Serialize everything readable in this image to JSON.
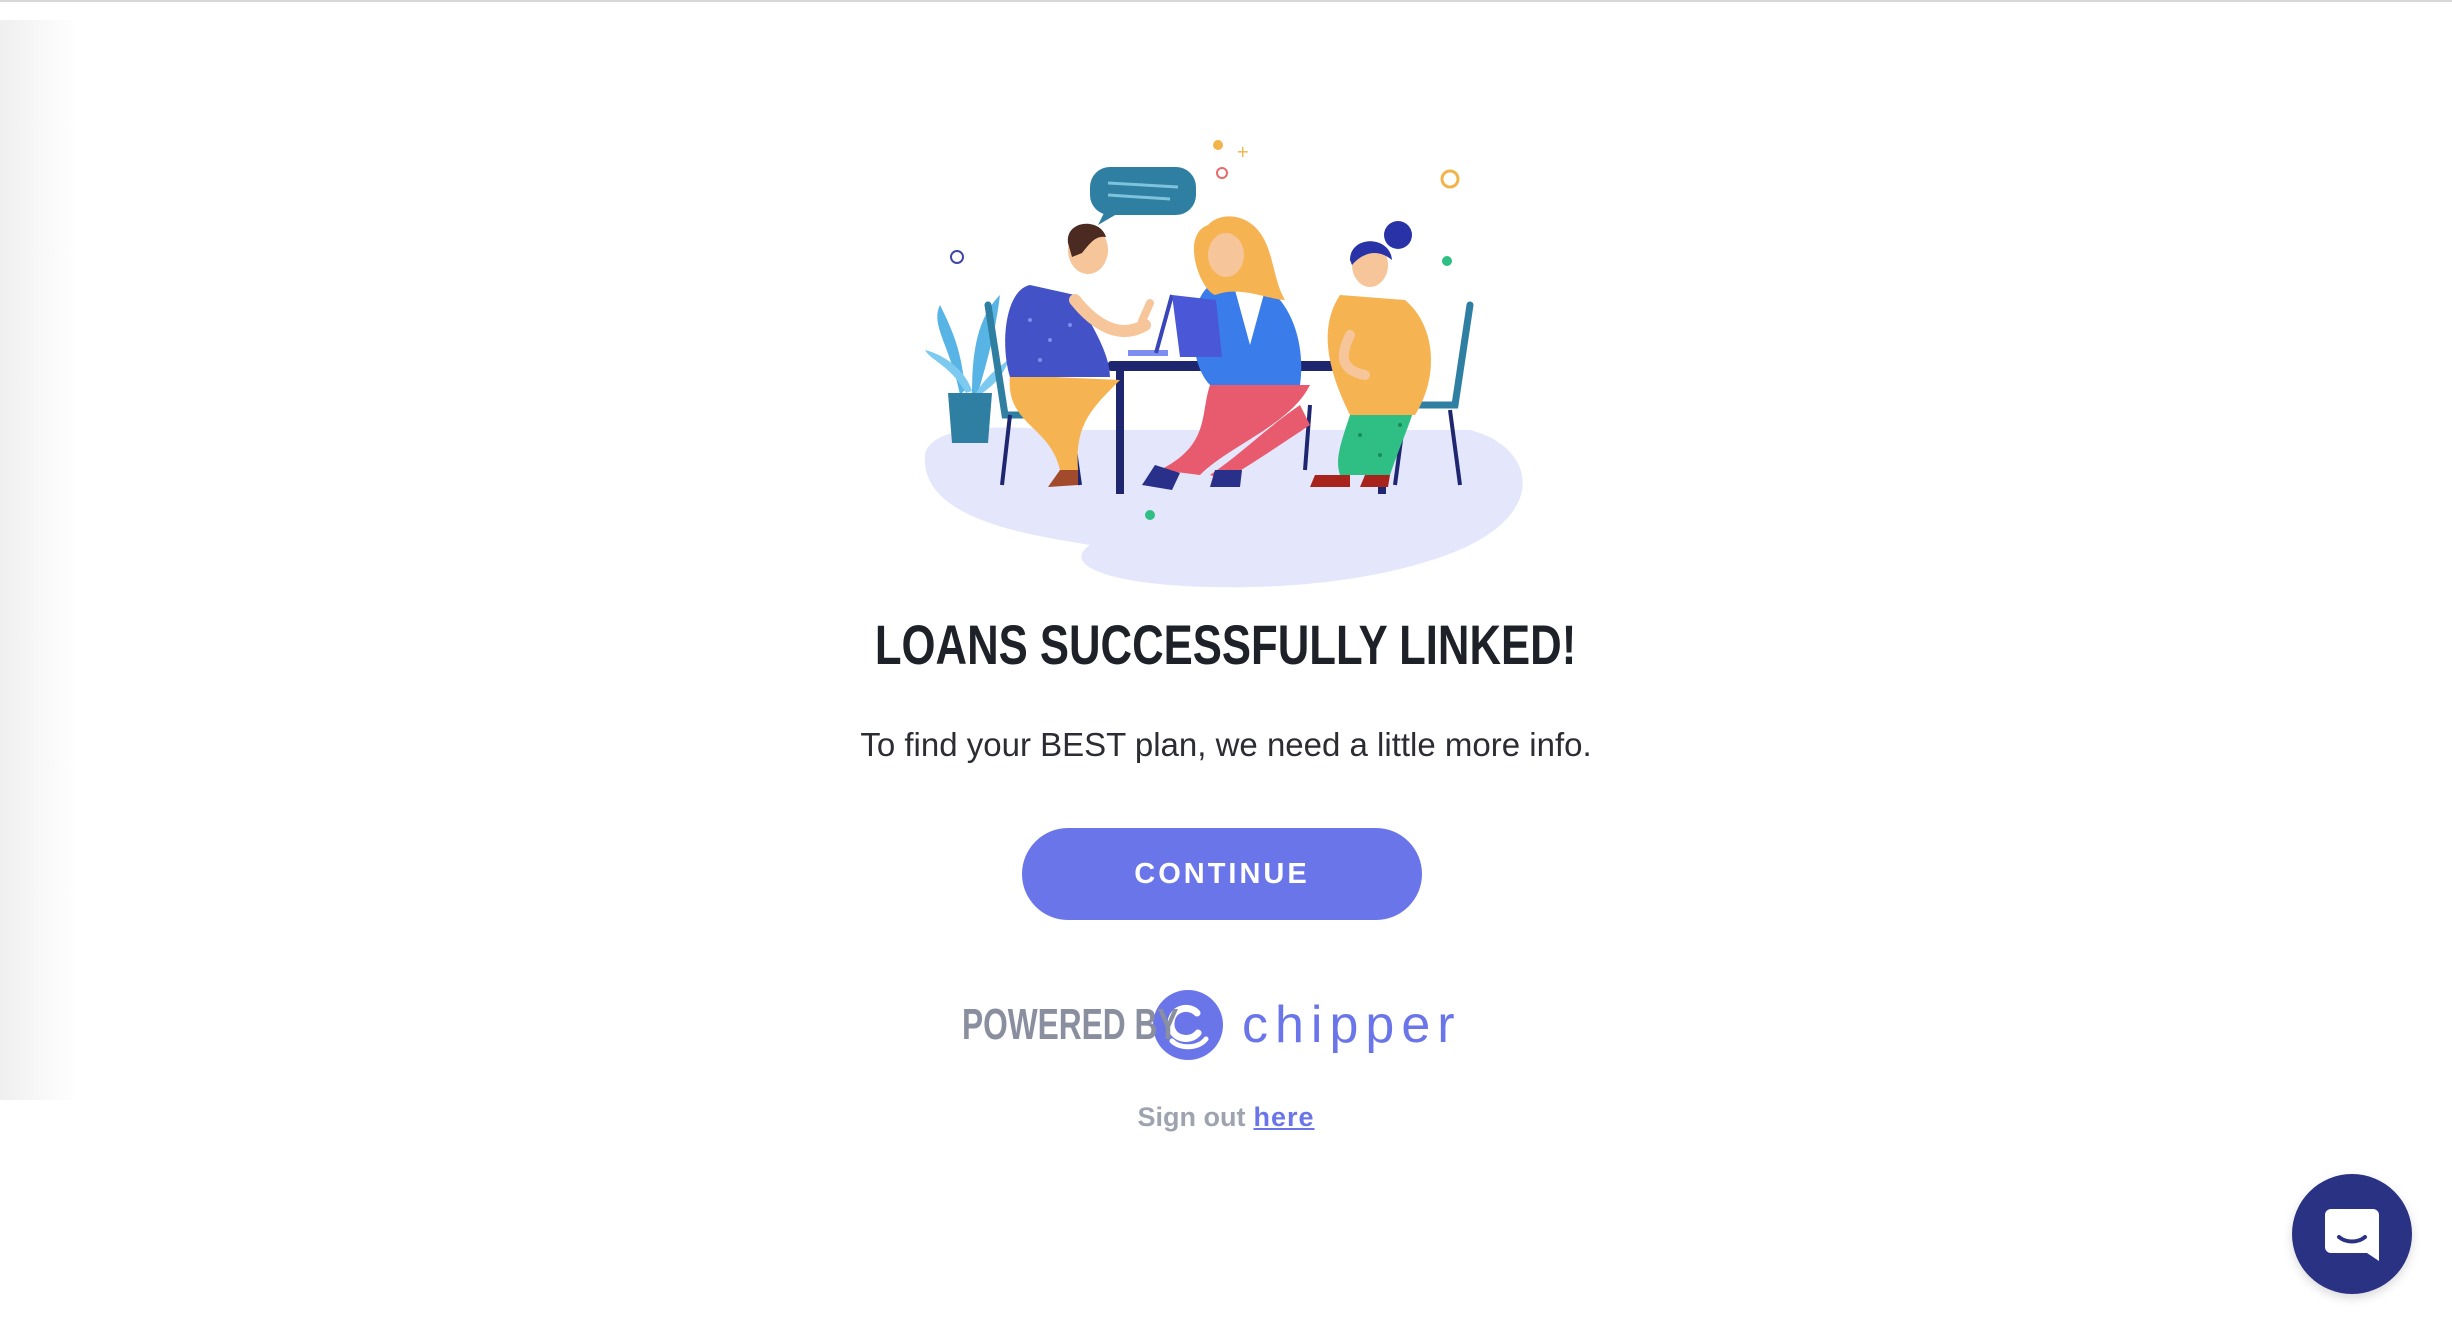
{
  "main": {
    "headline": "LOANS SUCCESSFULLY LINKED!",
    "subtitle": "To find your BEST plan, we need a little more info.",
    "continue_label": "CONTINUE"
  },
  "footer": {
    "powered_by": "POWERED BY",
    "brand_name": "chipper",
    "signout_text": "Sign out",
    "signout_link": "here"
  },
  "colors": {
    "accent": "#6b75ea",
    "headline": "#1f2129",
    "chat_launcher": "#2a3283"
  },
  "icons": {
    "illustration": "team-meeting-illustration",
    "brand_logo": "chipper-logo-icon",
    "chat": "chat-bubble-icon"
  }
}
